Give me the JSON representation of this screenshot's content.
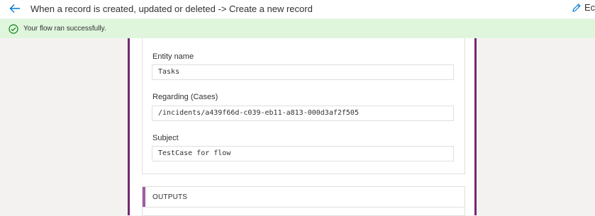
{
  "header": {
    "title": "When a record is created, updated or deleted -> Create a new record",
    "back_icon": "arrow-left-icon",
    "edit_icon": "pencil-icon",
    "edit_label": "Ec"
  },
  "banner": {
    "icon": "check-circle-icon",
    "message": "Your flow ran successfully.",
    "background": "#dff6dd",
    "icon_color": "#107c10"
  },
  "inputs": {
    "fields": [
      {
        "label": "Entity name",
        "value": "Tasks"
      },
      {
        "label": "Regarding (Cases)",
        "value": "/incidents/a439f66d-c039-eb11-a813-000d3af2f505"
      },
      {
        "label": "Subject",
        "value": "TestCase for flow"
      }
    ]
  },
  "outputs": {
    "title": "OUTPUTS"
  },
  "colors": {
    "card_border": "#742774",
    "outputs_accent": "#a25aa3",
    "back_arrow": "#0078d4"
  }
}
